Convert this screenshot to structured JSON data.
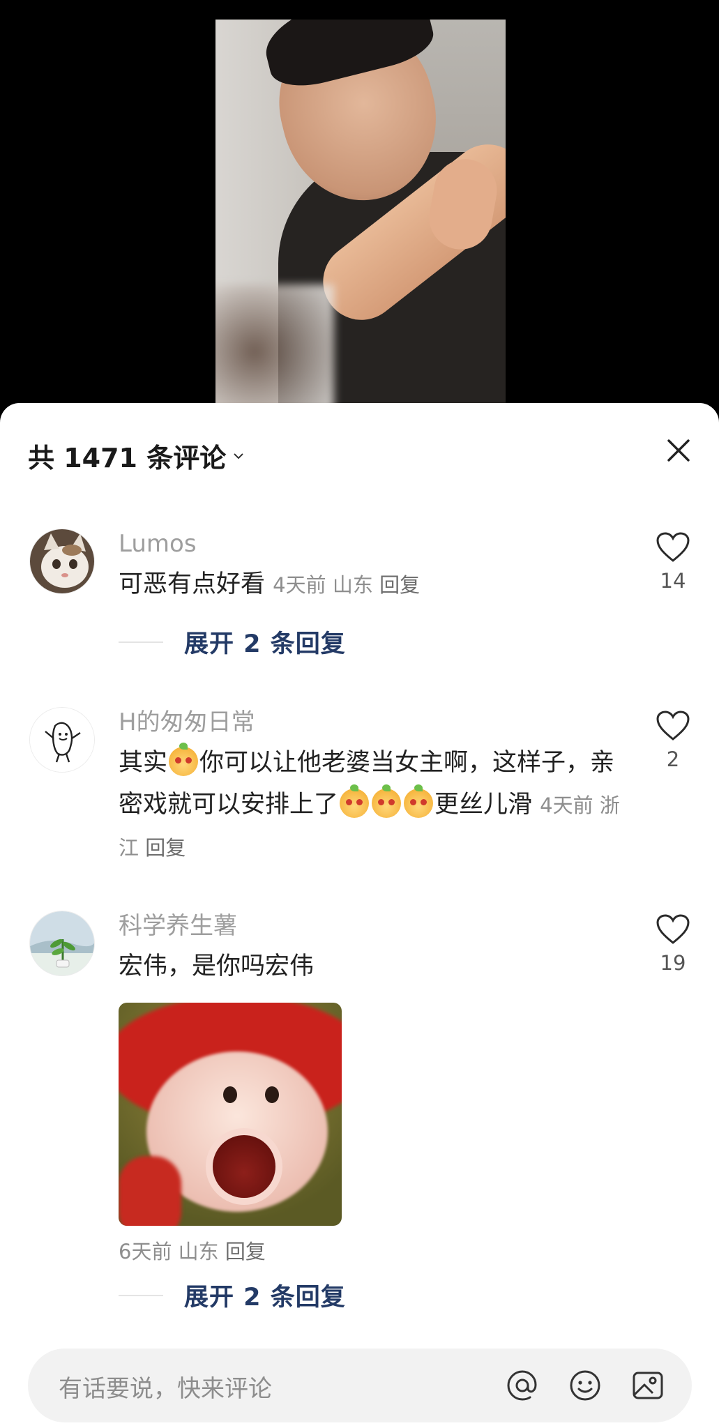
{
  "video": {
    "icon": "video-frame-man-in-black-suit"
  },
  "sheet": {
    "title": "共 1471 条评论",
    "title_icon": "chevron-down-icon",
    "close_icon": "close-icon"
  },
  "comments": [
    {
      "username": "Lumos",
      "avatar_icon": "cat-avatar",
      "text": "可恶有点好看",
      "time": "4天前",
      "location": "山东",
      "reply_label": "回复",
      "likes": "14",
      "expand_label": "展开 2 条回复"
    },
    {
      "username": "H的匆匆日常",
      "avatar_icon": "doodle-avatar",
      "text_parts": [
        "其实",
        "你可以让他老婆当女主啊，这样子，亲密戏就可以安排上了",
        "更丝儿滑"
      ],
      "emoji_icon": "mango-face-emoji",
      "time": "4天前",
      "location": "浙江",
      "reply_label": "回复",
      "likes": "2"
    },
    {
      "username": "科学养生薯",
      "avatar_icon": "plant-avatar",
      "text": "宏伟，是你吗宏伟",
      "sticker_icon": "screaming-monkey-sticker",
      "time": "6天前",
      "location": "山东",
      "reply_label": "回复",
      "likes": "19",
      "expand_label": "展开 2 条回复"
    }
  ],
  "input": {
    "placeholder": "有话要说，快来评论",
    "icons": [
      "at-icon",
      "emoji-icon",
      "image-icon"
    ]
  },
  "colors": {
    "expand_link": "#233a66",
    "username": "#9e9e9e",
    "sheet_bg": "#ffffff"
  }
}
